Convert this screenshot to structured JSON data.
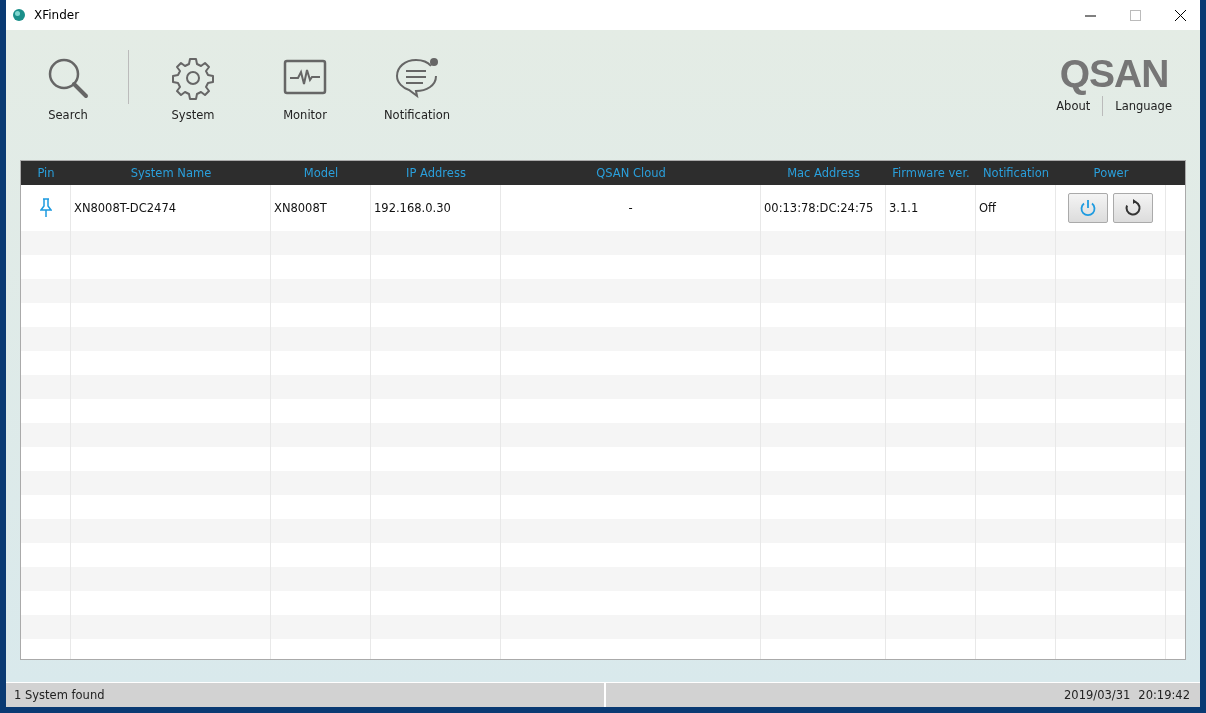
{
  "window": {
    "title": "XFinder"
  },
  "toolbar": [
    {
      "label": "Search",
      "kind": "search"
    },
    {
      "label": "System",
      "kind": "system"
    },
    {
      "label": "Monitor",
      "kind": "monitor"
    },
    {
      "label": "Notification",
      "kind": "notification"
    }
  ],
  "brand": {
    "logo": "QSAN",
    "links": [
      "About",
      "Language"
    ]
  },
  "table": {
    "columns": [
      "Pin",
      "System Name",
      "Model",
      "IP Address",
      "QSAN Cloud",
      "Mac Address",
      "Firmware ver.",
      "Notification",
      "Power"
    ],
    "rows": [
      {
        "cells": [
          {
            "kind": "pin",
            "pinned": true
          },
          {
            "kind": "text",
            "text": "XN8008T-DC2474"
          },
          {
            "kind": "text",
            "text": "XN8008T"
          },
          {
            "kind": "text",
            "text": "192.168.0.30"
          },
          {
            "kind": "text",
            "text": "-"
          },
          {
            "kind": "text",
            "text": "00:13:78:DC:24:75"
          },
          {
            "kind": "text",
            "text": "3.1.1"
          },
          {
            "kind": "text",
            "text": "Off"
          },
          {
            "kind": "power"
          }
        ]
      }
    ]
  },
  "status_bar": {
    "message": "1 System found",
    "date": "2019/03/31",
    "time": "20:19:42"
  }
}
